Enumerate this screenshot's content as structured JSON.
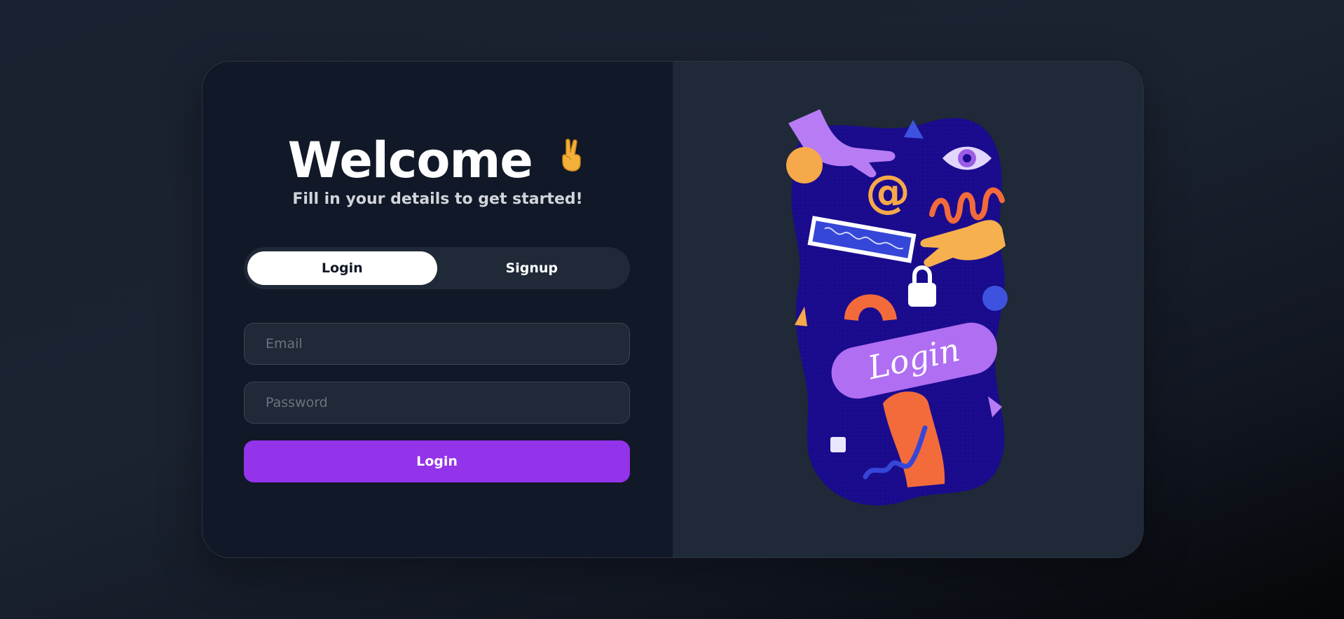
{
  "welcome": {
    "title": "Welcome",
    "subtitle": "Fill in your details to get started!"
  },
  "tabs": [
    {
      "label": "Login",
      "active": true
    },
    {
      "label": "Signup",
      "active": false
    }
  ],
  "form": {
    "email_placeholder": "Email",
    "password_placeholder": "Password",
    "submit_label": "Login"
  },
  "illustration": {
    "text": "Login"
  },
  "colors": {
    "accent": "#9333ea",
    "card_left": "#111827",
    "card_right": "#1f2937",
    "illustration_bg": "#1a0b8c"
  }
}
